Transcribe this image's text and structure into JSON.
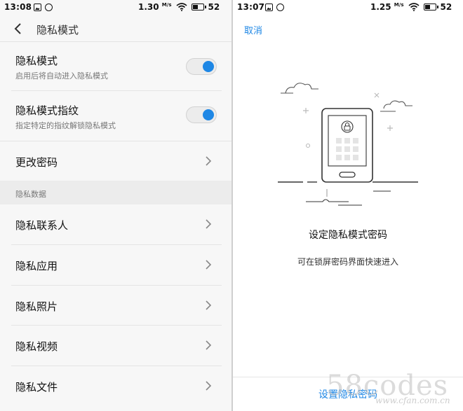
{
  "left": {
    "status": {
      "time": "13:08",
      "speed": "1.30",
      "speed_unit": "M/s",
      "battery": "52"
    },
    "header": {
      "title": "隐私模式"
    },
    "settings": [
      {
        "title": "隐私模式",
        "subtitle": "启用后将自动进入隐私模式",
        "toggle_on": true
      },
      {
        "title": "隐私模式指纹",
        "subtitle": "指定特定的指纹解锁隐私模式",
        "toggle_on": true
      },
      {
        "title": "更改密码"
      }
    ],
    "section_label": "隐私数据",
    "data_items": [
      {
        "title": "隐私联系人"
      },
      {
        "title": "隐私应用"
      },
      {
        "title": "隐私照片"
      },
      {
        "title": "隐私视频"
      },
      {
        "title": "隐私文件"
      }
    ]
  },
  "right": {
    "status": {
      "time": "13:07",
      "speed": "1.25",
      "speed_unit": "M/s",
      "battery": "52"
    },
    "cancel_label": "取消",
    "title": "设定隐私模式密码",
    "description": "可在锁屏密码界面快速进入",
    "action_label": "设置隐私密码"
  },
  "watermark": {
    "text": "58codes",
    "sub": "www.cfan.com.cn"
  },
  "colors": {
    "accent": "#1e87e5",
    "toggle_knob": "#1e87e5"
  },
  "icons": {
    "back": "back-arrow-icon",
    "chevron": "chevron-right-icon",
    "lock": "lock-icon",
    "wifi": "wifi-icon",
    "battery": "battery-icon"
  }
}
